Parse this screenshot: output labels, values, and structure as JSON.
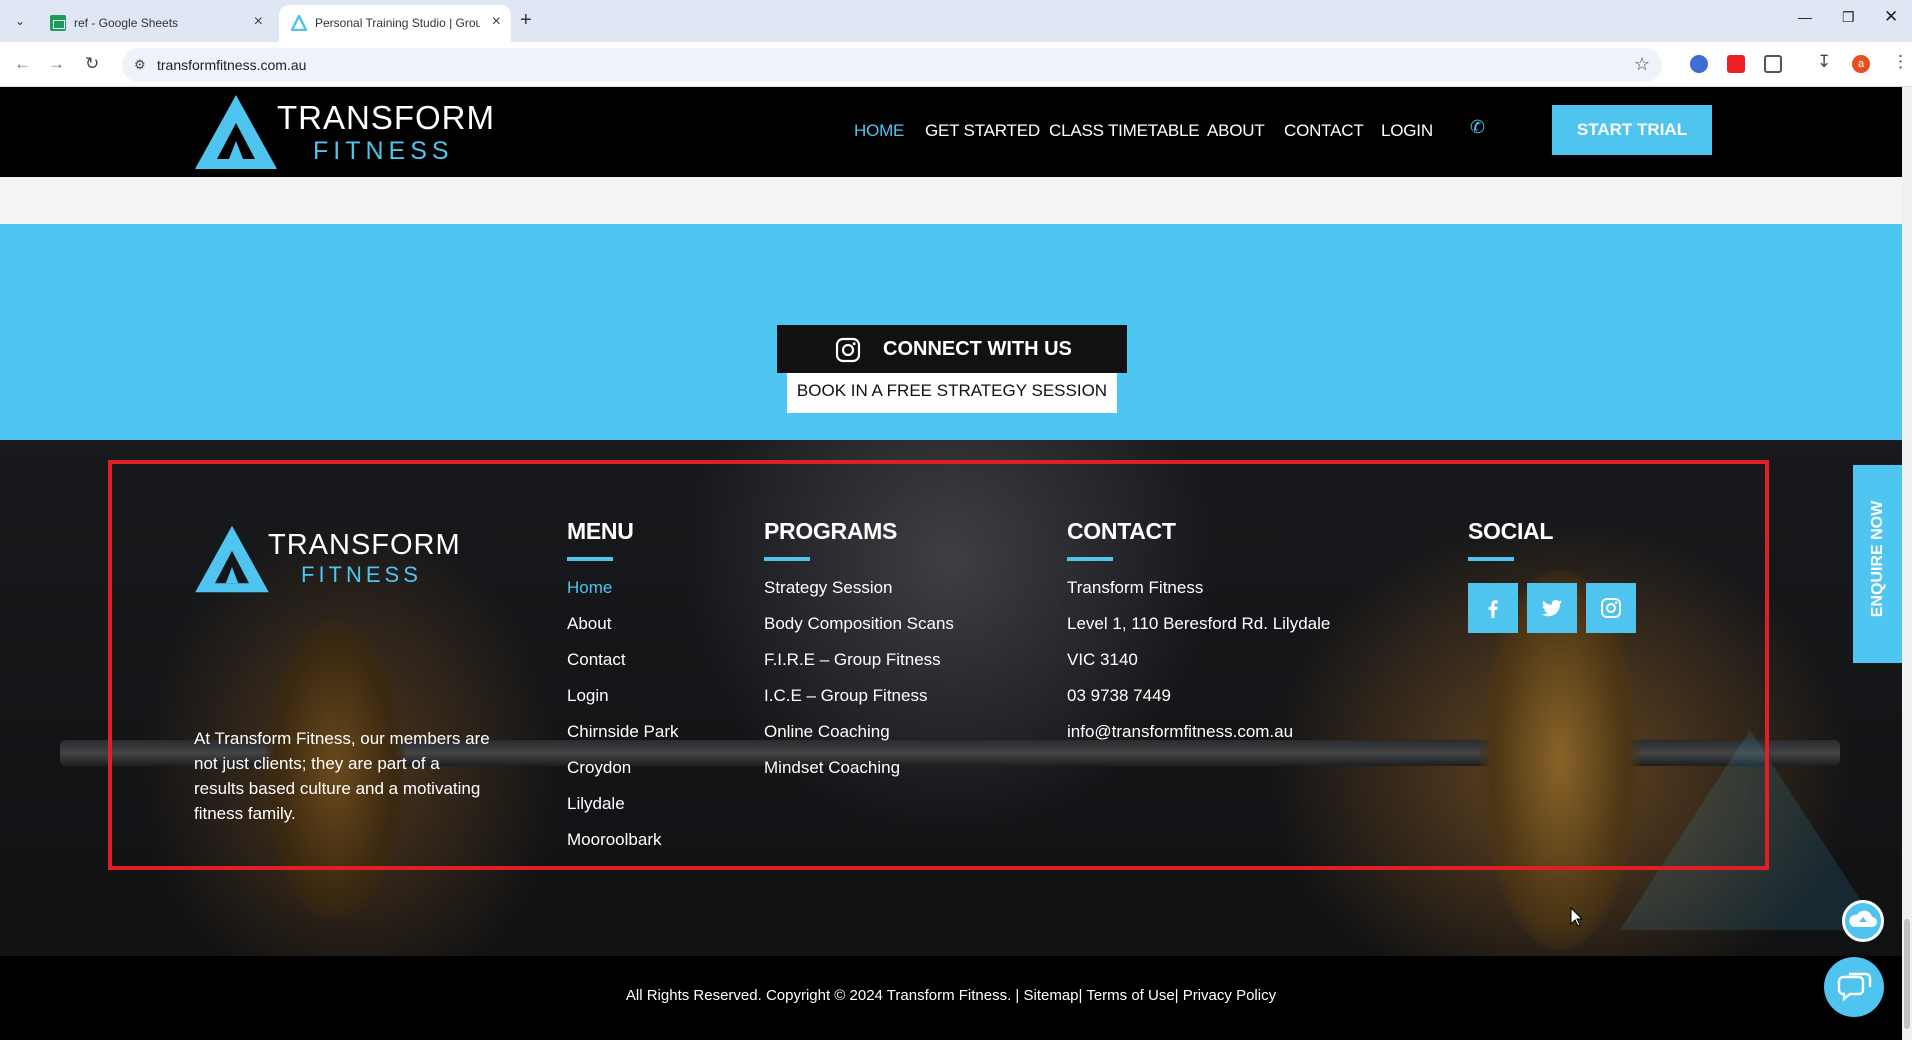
{
  "browser": {
    "tabs": [
      {
        "title": "ref - Google Sheets",
        "active": false,
        "icon": "sheets-icon"
      },
      {
        "title": "Personal Training Studio | Group",
        "active": true,
        "icon": "transform-favicon"
      }
    ],
    "url": "transformfitness.com.au",
    "profile_initial": "a"
  },
  "header": {
    "logo": {
      "line1": "TRANSFORM",
      "line2": "FITNESS"
    },
    "nav": [
      "HOME",
      "GET STARTED",
      "CLASS TIMETABLE",
      "ABOUT",
      "CONTACT",
      "LOGIN"
    ],
    "active_nav": "HOME",
    "cta": "START TRIAL"
  },
  "cta_section": {
    "connect_label": "CONNECT WITH US",
    "book_label": "BOOK IN A FREE STRATEGY SESSION"
  },
  "footer": {
    "logo": {
      "line1": "TRANSFORM",
      "line2": "FITNESS"
    },
    "description": "At Transform Fitness, our members are not just clients; they are part of a results based culture and a motivating fitness family.",
    "menu": {
      "heading": "MENU",
      "items": [
        "Home",
        "About",
        "Contact",
        "Login",
        "Chirnside Park",
        "Croydon",
        "Lilydale",
        "Mooroolbark"
      ]
    },
    "programs": {
      "heading": "PROGRAMS",
      "items": [
        "Strategy Session",
        "Body Composition Scans",
        "F.I.R.E – Group Fitness",
        "I.C.E – Group Fitness",
        "Online Coaching",
        "Mindset Coaching"
      ]
    },
    "contact": {
      "heading": "CONTACT",
      "items": [
        "Transform Fitness",
        "Level 1, 110 Beresford Rd. Lilydale",
        "VIC 3140",
        "03 9738 7449",
        "info@transformfitness.com.au"
      ]
    },
    "social": {
      "heading": "SOCIAL",
      "icons": [
        "facebook-icon",
        "twitter-icon",
        "instagram-icon"
      ]
    }
  },
  "enquire_label": "ENQUIRE NOW",
  "copyright": "All Rights Reserved. Copyright © 2024 Transform Fitness. | Sitemap| Terms of Use| Privacy Policy",
  "colors": {
    "accent": "#4ec4ef",
    "band": "#4ec6f1",
    "highlight": "#e01e26"
  }
}
